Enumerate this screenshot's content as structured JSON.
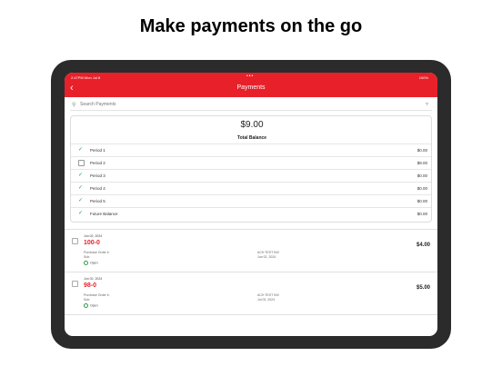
{
  "headline": "Make payments on the go",
  "status_bar": {
    "left": "2:47PM  Mon Jul 8",
    "center": "•••",
    "right": "100%"
  },
  "nav": {
    "back_icon": "chevron-left-icon",
    "title": "Payments"
  },
  "search": {
    "placeholder": "Search Payments",
    "icon": "search-icon",
    "filter_icon": "filter-icon"
  },
  "balance": {
    "total": "$9.00",
    "total_label": "Total Balance",
    "periods": [
      {
        "label": "Period 1",
        "amount": "$0.00",
        "checked": true
      },
      {
        "label": "Period 2",
        "amount": "$9.00",
        "checked": false
      },
      {
        "label": "Period 3",
        "amount": "$0.00",
        "checked": true
      },
      {
        "label": "Period 4",
        "amount": "$0.00",
        "checked": true
      },
      {
        "label": "Period 5",
        "amount": "$0.00",
        "checked": true
      },
      {
        "label": "Future Balance",
        "amount": "$0.00",
        "checked": true
      }
    ]
  },
  "invoices": [
    {
      "date": "Jun 02, 2024",
      "number": "100-0",
      "field1": "Purchase Order #:",
      "field2": "Sub:",
      "status": "Open",
      "meta1": "ACH TEST INV",
      "meta2": "Jun 02, 2024",
      "amount": "$4.00"
    },
    {
      "date": "Jun 02, 2024",
      "number": "98-0",
      "field1": "Purchase Order #:",
      "field2": "Sub:",
      "status": "Open",
      "meta1": "ACH TEST INV",
      "meta2": "Jul 02, 2024",
      "amount": "$5.00"
    }
  ],
  "colors": {
    "accent": "#e8202a",
    "check": "#2e9c48"
  }
}
